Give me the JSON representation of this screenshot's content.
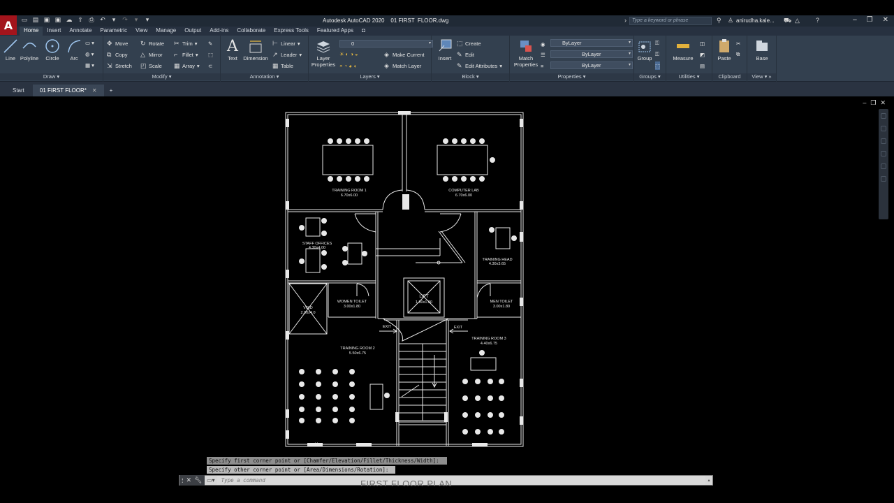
{
  "window": {
    "title": "Autodesk AutoCAD 2020    01 FIRST  FLOOR.dwg",
    "search_placeholder": "Type a keyword or phrase",
    "user": "anirudha.kale...",
    "logo": "A"
  },
  "ribbon_tabs": [
    "Home",
    "Insert",
    "Annotate",
    "Parametric",
    "View",
    "Manage",
    "Output",
    "Add-ins",
    "Collaborate",
    "Express Tools",
    "Featured Apps"
  ],
  "ribbon": {
    "draw": {
      "label": "Draw",
      "line": "Line",
      "polyline": "Polyline",
      "circle": "Circle",
      "arc": "Arc"
    },
    "modify": {
      "label": "Modify",
      "move": "Move",
      "rotate": "Rotate",
      "trim": "Trim",
      "copy": "Copy",
      "mirror": "Mirror",
      "fillet": "Fillet",
      "stretch": "Stretch",
      "scale": "Scale",
      "array": "Array"
    },
    "annotation": {
      "label": "Annotation",
      "text": "Text",
      "dimension": "Dimension",
      "linear": "Linear",
      "leader": "Leader",
      "table": "Table"
    },
    "layers": {
      "label": "Layers",
      "layer_properties": "Layer Properties",
      "current_layer": "0",
      "make_current": "Make Current",
      "match_layer": "Match Layer"
    },
    "block": {
      "label": "Block",
      "insert": "Insert",
      "create": "Create",
      "edit": "Edit",
      "edit_attributes": "Edit Attributes"
    },
    "properties": {
      "label": "Properties",
      "match_properties": "Match Properties",
      "color": "ByLayer",
      "linetype": "ByLayer",
      "lineweight": "ByLayer"
    },
    "groups": {
      "label": "Groups",
      "group": "Group"
    },
    "utilities": {
      "label": "Utilities",
      "measure": "Measure"
    },
    "clipboard": {
      "label": "Clipboard",
      "paste": "Paste"
    },
    "view": {
      "label": "View",
      "base": "Base"
    }
  },
  "doc_tabs": {
    "start": "Start",
    "file": "01 FIRST  FLOOR*"
  },
  "plan": {
    "rooms": [
      {
        "name": "TRAINING ROOM 1",
        "size": "6.70x6.00"
      },
      {
        "name": "COMPUTER LAB",
        "size": "6.70x6.00"
      },
      {
        "name": "STAFF OFFICES",
        "size": "4.30x4.00"
      },
      {
        "name": "TRAINING HEAD",
        "size": "4.30x3.65"
      },
      {
        "name": "WOMEN TOILET",
        "size": "3.00x1.80"
      },
      {
        "name": "LIFT",
        "size": "1.80x1.80"
      },
      {
        "name": "MEN TOILET",
        "size": "3.00x1.80"
      },
      {
        "name": "VOID",
        "size": "2.90x4.0"
      },
      {
        "name": "TRAINING ROOM 2",
        "size": "5.50x6.75"
      },
      {
        "name": "TRAINING ROOM 3",
        "size": "4.40x6.75"
      }
    ],
    "exit_left": "EXIT",
    "exit_right": "EXIT",
    "title": "FIRST FLOOR PLAN"
  },
  "command": {
    "history_1": "Specify first corner point or [Chamfer/Elevation/Fillet/Thickness/Width]:",
    "history_2": "Specify other corner point or [Area/Dimensions/Rotation]:",
    "placeholder": "Type a command"
  }
}
